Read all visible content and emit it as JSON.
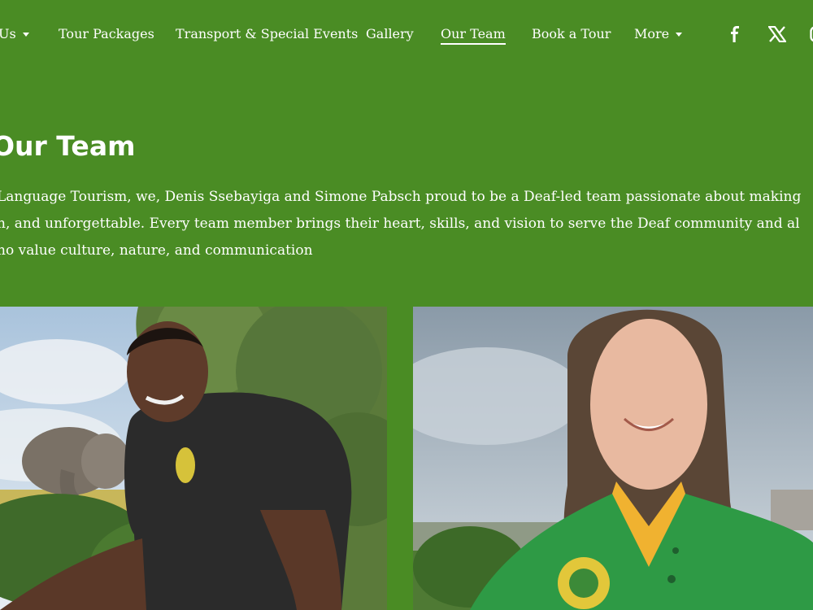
{
  "nav": {
    "items": [
      {
        "label": "Us",
        "dropdown": true
      },
      {
        "label": "Tour Packages"
      },
      {
        "label": "Transport & Special Events"
      },
      {
        "label": "Gallery"
      },
      {
        "label": "Our Team",
        "active": true
      },
      {
        "label": "Book a Tour"
      },
      {
        "label": "More",
        "dropdown": true
      }
    ],
    "social_icons": [
      "facebook-icon",
      "x-icon",
      "instagram-icon"
    ]
  },
  "page": {
    "title": "Our Team",
    "intro_lines": [
      "Language Tourism,  we, Denis Ssebayiga and Simone Pabsch proud to be a Deaf-led team passionate about making",
      "n, and unforgettable. Every team member brings their heart, skills, and vision to serve the Deaf community and al",
      "no value culture, nature, and communication"
    ]
  },
  "team": [
    {
      "photo": "team-member-photo-denis"
    },
    {
      "photo": "team-member-photo-simone"
    }
  ],
  "colors": {
    "background": "#4a8c24",
    "text": "#ffffff"
  }
}
